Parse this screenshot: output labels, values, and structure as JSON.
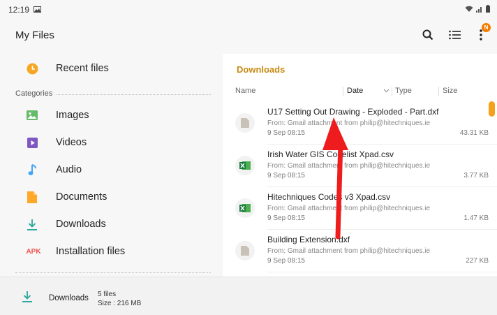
{
  "status_bar": {
    "time": "12:19"
  },
  "app_bar": {
    "title": "My Files",
    "badge": "N"
  },
  "sidebar": {
    "recent_label": "Recent files",
    "categories_label": "Categories",
    "items": [
      {
        "label": "Images",
        "icon": "image-icon",
        "color": "#66bb6a"
      },
      {
        "label": "Videos",
        "icon": "video-icon",
        "color": "#7e57c2"
      },
      {
        "label": "Audio",
        "icon": "music-note-icon",
        "color": "#42a5f5"
      },
      {
        "label": "Documents",
        "icon": "document-icon",
        "color": "#ffa726"
      },
      {
        "label": "Downloads",
        "icon": "download-icon",
        "color": "#26a69a"
      },
      {
        "label": "Installation files",
        "icon": "apk-icon",
        "icon_text": "APK",
        "color": "#ef5350"
      }
    ]
  },
  "panel": {
    "title": "Downloads",
    "columns": {
      "name": "Name",
      "date": "Date",
      "type": "Type",
      "size": "Size"
    },
    "files": [
      {
        "name": "U17 Setting Out Drawing - Exploded - Part.dxf",
        "from": "From: Gmail attachment from philip@hitechniques.ie",
        "date": "9 Sep 08:15",
        "size": "43.31 KB",
        "icon": "generic-file-icon"
      },
      {
        "name": "Irish Water GIS Codelist Xpad.csv",
        "from": "From: Gmail attachment from philip@hitechniques.ie",
        "date": "9 Sep 08:15",
        "size": "3.77 KB",
        "icon": "excel-file-icon"
      },
      {
        "name": "Hitechniques Codes v3 Xpad.csv",
        "from": "From: Gmail attachment from philip@hitechniques.ie",
        "date": "9 Sep 08:15",
        "size": "1.47 KB",
        "icon": "excel-file-icon"
      },
      {
        "name": "Building Extension.dxf",
        "from": "From: Gmail attachment from philip@hitechniques.ie",
        "date": "9 Sep 08:15",
        "size": "227 KB",
        "icon": "generic-file-icon"
      }
    ]
  },
  "footer": {
    "label": "Downloads",
    "count": "5 files",
    "size": "Size : 216 MB"
  },
  "colors": {
    "accent": "#c78a12",
    "annotation_arrow": "#ee1c1c"
  }
}
